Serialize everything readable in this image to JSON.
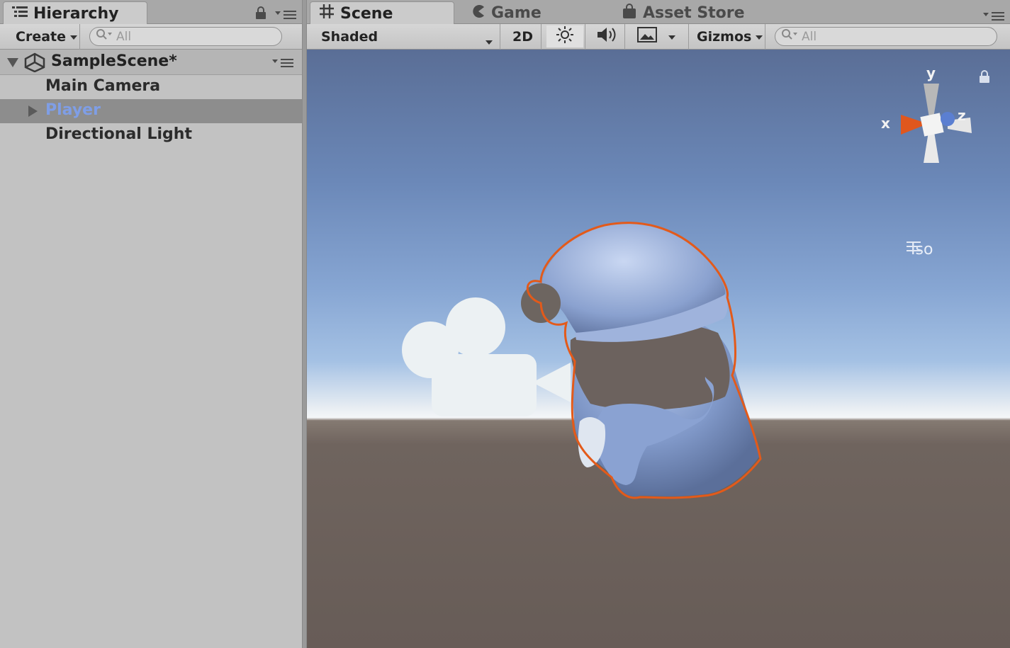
{
  "hierarchy": {
    "tab_label": "Hierarchy",
    "create_label": "Create",
    "search_placeholder": "All",
    "scene_name": "SampleScene*",
    "items": [
      {
        "label": "Main Camera",
        "selected": false,
        "has_children": false
      },
      {
        "label": "Player",
        "selected": true,
        "has_children": true
      },
      {
        "label": "Directional Light",
        "selected": false,
        "has_children": false
      }
    ]
  },
  "scene_panel": {
    "tabs": [
      {
        "label": "Scene",
        "icon": "grid-icon",
        "active": true
      },
      {
        "label": "Game",
        "icon": "pacman-icon",
        "active": false
      },
      {
        "label": "Asset Store",
        "icon": "bag-icon",
        "active": false
      }
    ],
    "shading_mode": "Shaded",
    "mode_2d_label": "2D",
    "gizmos_label": "Gizmos",
    "search_placeholder": "All",
    "projection_label": "Iso",
    "gizmo_axes": {
      "x": "x",
      "y": "y",
      "z": "z"
    }
  },
  "colors": {
    "selection_outline": "#e35a1a",
    "selected_text": "#7f9ee6",
    "x_axis": "#e0571d",
    "z_axis": "#5b7fd1"
  }
}
